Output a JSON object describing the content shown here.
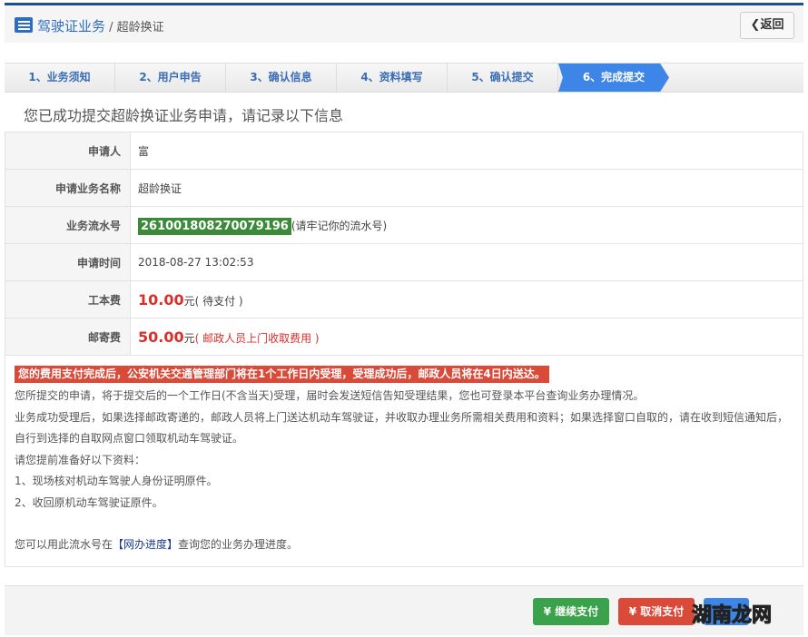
{
  "header": {
    "section": "驾驶证业务",
    "separator": " / ",
    "page": "超龄换证",
    "back": "❮返回"
  },
  "steps": [
    "1、业务须知",
    "2、用户申告",
    "3、确认信息",
    "4、资料填写",
    "5、确认提交",
    "6、完成提交"
  ],
  "title": "您已成功提交超龄换证业务申请，请记录以下信息",
  "rows": {
    "applicant": {
      "label": "申请人",
      "value": "富"
    },
    "business": {
      "label": "申请业务名称",
      "value": "超龄换证"
    },
    "serial": {
      "label": "业务流水号",
      "value": "261001808270079196",
      "note": "(请牢记你的流水号)"
    },
    "time": {
      "label": "申请时间",
      "value": "2018-08-27 13:02:53"
    },
    "cost": {
      "label": "工本费",
      "amount": "10.00",
      "unit": "元",
      "note": "( 待支付 )"
    },
    "postage": {
      "label": "邮寄费",
      "amount": "50.00",
      "unit": "元",
      "note": "( 邮政人员上门收取费用 )"
    }
  },
  "notice": {
    "warning": "您的费用支付完成后，公安机关交通管理部门将在1个工作日内受理，受理成功后，邮政人员将在4日内送达。",
    "p1": "您所提交的申请，将于提交后的一个工作日(不含当天)受理，届时会发送短信告知受理结果，您也可登录本平台查询业务办理情况。",
    "p2": "业务成功受理后，如果选择邮政寄递的，邮政人员将上门送达机动车驾驶证，并收取办理业务所需相关费用和资料；如果选择窗口自取的，请在收到短信通知后，",
    "p3": "自行到选择的自取网点窗口领取机动车驾驶证。",
    "p4": "请您提前准备好以下资料：",
    "p5": "1、现场核对机动车驾驶人身份证明原件。",
    "p6": "2、收回原机动车驾驶证原件。",
    "p7a": "您可以用此流水号在",
    "p7link": "【网办进度】",
    "p7b": "查询您的业务办理进度。"
  },
  "footer": {
    "continue": "¥ 继续支付",
    "cancel": "¥ 取消支付"
  },
  "watermark": {
    "a": "湖南",
    "b": "龙网"
  }
}
